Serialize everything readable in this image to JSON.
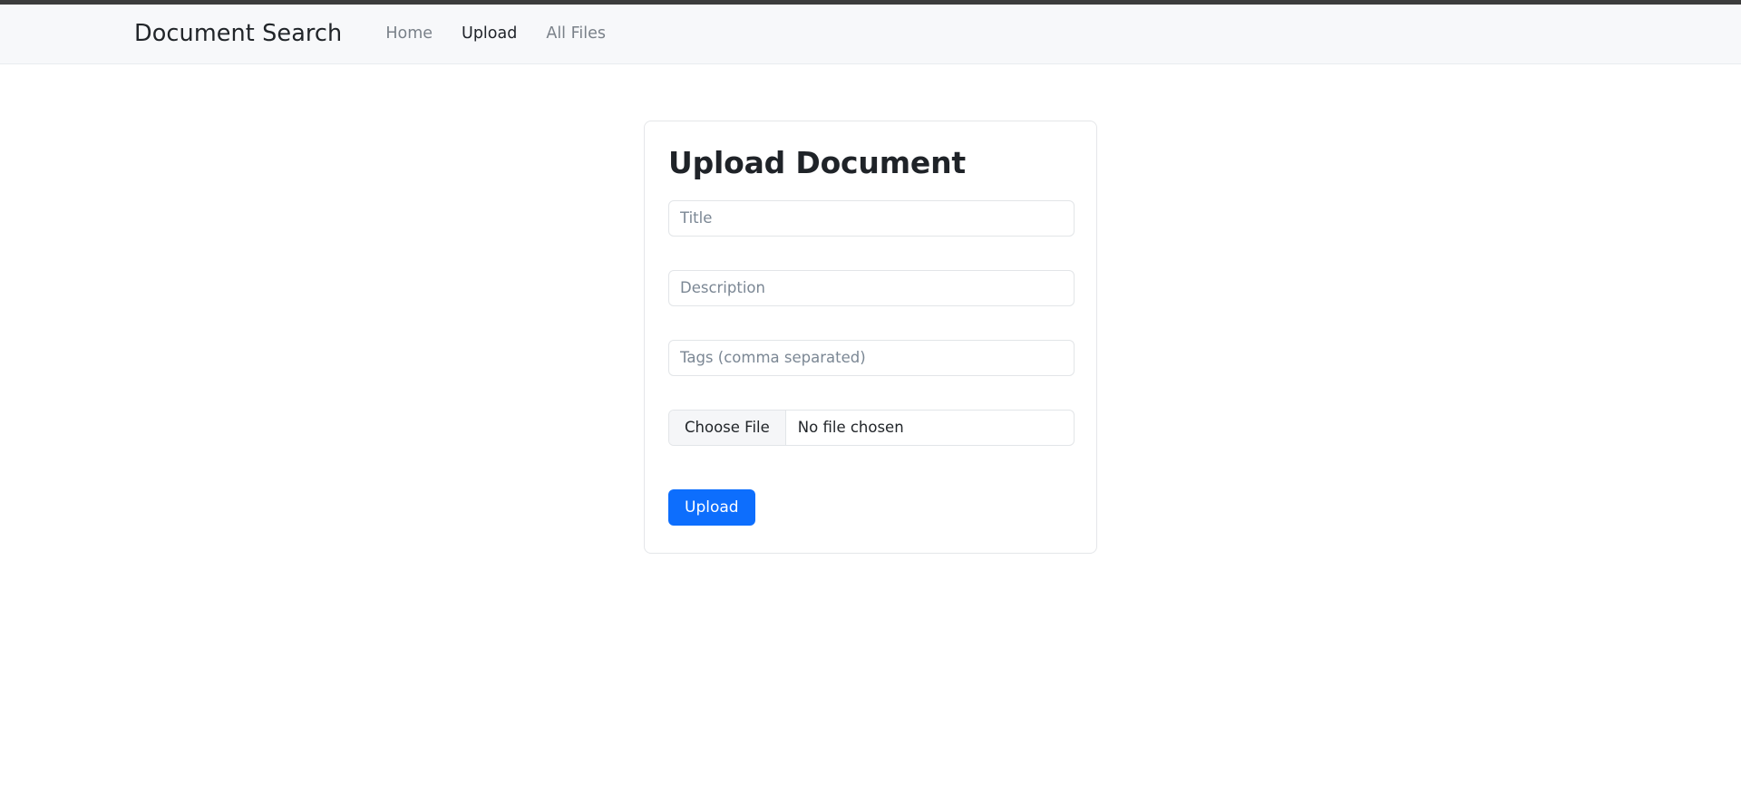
{
  "browser": {
    "chrome_strip_color": "#3c3c3c"
  },
  "navbar": {
    "brand": "Document Search",
    "background_color": "#f7f8fa",
    "links": [
      {
        "label": "Home",
        "active": false
      },
      {
        "label": "Upload",
        "active": true
      },
      {
        "label": "All Files",
        "active": false
      }
    ]
  },
  "card": {
    "title": "Upload Document",
    "fields": [
      {
        "name": "title",
        "value": "",
        "placeholder": "Title"
      },
      {
        "name": "description",
        "value": "",
        "placeholder": "Description"
      },
      {
        "name": "tags",
        "value": "",
        "placeholder": "Tags (comma separated)"
      }
    ],
    "file_input": {
      "button_label": "Choose File",
      "status_text": "No file chosen"
    },
    "submit": {
      "label": "Upload",
      "color": "#0d6efd"
    }
  }
}
